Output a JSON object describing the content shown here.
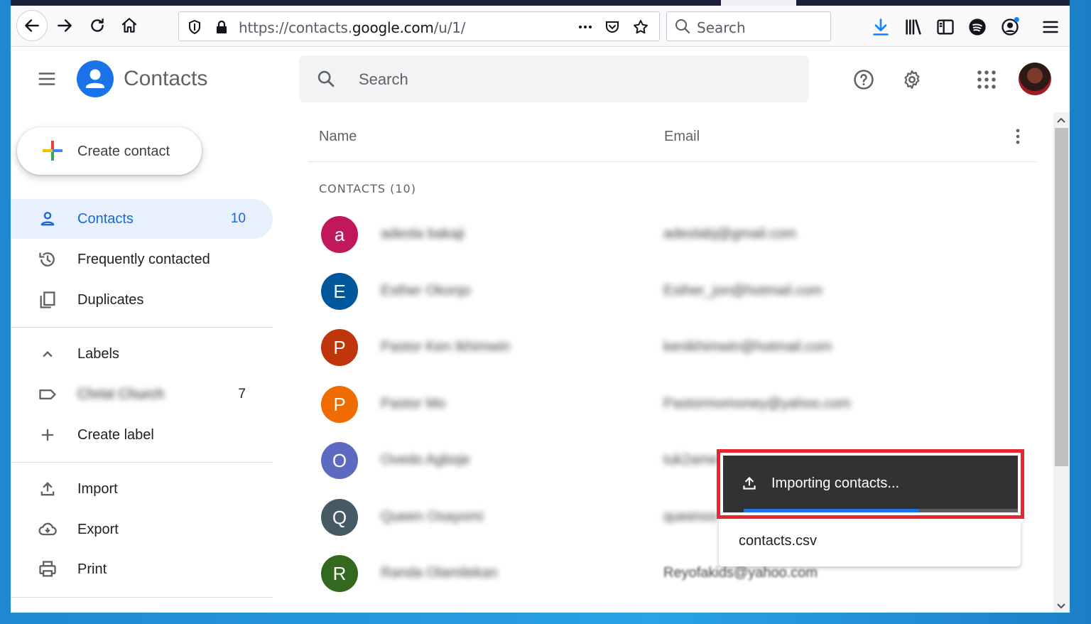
{
  "browser": {
    "url_prefix": "https://contacts.",
    "url_domain": "google.com",
    "url_suffix": "/u/1/",
    "search_placeholder": "Search"
  },
  "app": {
    "title": "Contacts",
    "search_placeholder": "Search"
  },
  "sidebar": {
    "create_label": "Create contact",
    "items": [
      {
        "label": "Contacts",
        "count": "10"
      },
      {
        "label": "Frequently contacted"
      },
      {
        "label": "Duplicates"
      },
      {
        "label": "Labels"
      },
      {
        "label": "Christ Church",
        "count": "7"
      },
      {
        "label": "Create label"
      },
      {
        "label": "Import"
      },
      {
        "label": "Export"
      },
      {
        "label": "Print"
      }
    ]
  },
  "list": {
    "col_name": "Name",
    "col_email": "Email",
    "section": "CONTACTS (10)",
    "rows": [
      {
        "initial": "a",
        "color": "#c2185b",
        "name": "adeola bakaji",
        "email": "adeolabj@gmail.com"
      },
      {
        "initial": "E",
        "color": "#01579b",
        "name": "Esther Okonjo",
        "email": "Esther_jon@hotmail.com"
      },
      {
        "initial": "P",
        "color": "#bf360c",
        "name": "Pastor Ken Ikhimwin",
        "email": "kenikhimwin@hotmail.com"
      },
      {
        "initial": "P",
        "color": "#ef6c00",
        "name": "Pastor Mo",
        "email": "Pastormomoney@yahoo.com"
      },
      {
        "initial": "O",
        "color": "#5c6bc0",
        "name": "Ovedo Agboje",
        "email": "tuk2ame"
      },
      {
        "initial": "Q",
        "color": "#455a64",
        "name": "Queen Osayomi",
        "email": "queenos"
      },
      {
        "initial": "R",
        "color": "#33691e",
        "name": "Randa Olamilekan",
        "email": "Reyofakids@yahoo.com"
      }
    ]
  },
  "import": {
    "status": "Importing contacts...",
    "file": "contacts.csv",
    "progress_percent": 64
  }
}
